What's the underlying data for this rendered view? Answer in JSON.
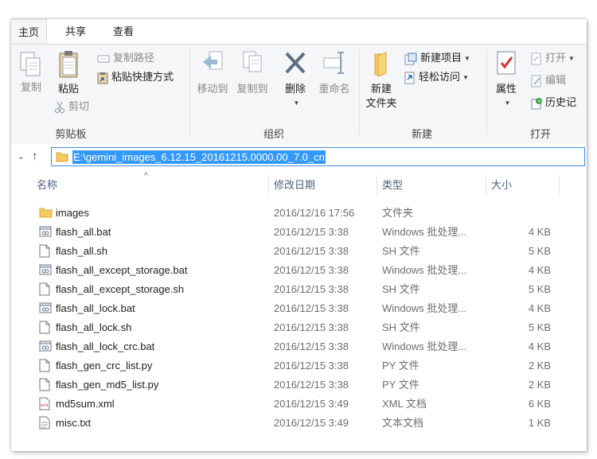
{
  "tabs": [
    "主页",
    "共享",
    "查看"
  ],
  "clipboard": {
    "copy": "复制",
    "paste": "粘贴",
    "copy_path": "复制路径",
    "paste_shortcut": "粘贴快捷方式",
    "cut": "剪切",
    "group": "剪贴板"
  },
  "organize": {
    "move_to": "移动到",
    "copy_to": "复制到",
    "delete": "删除",
    "rename": "重命名",
    "group": "组织"
  },
  "new": {
    "new_folder_line1": "新建",
    "new_folder_line2": "文件夹",
    "new_item": "新建项目",
    "easy_access": "轻松访问",
    "group": "新建"
  },
  "open": {
    "properties": "属性",
    "open": "打开",
    "edit": "编辑",
    "history": "历史记",
    "group": "打开"
  },
  "address": {
    "path": "E:\\gemini_images_6.12.15_20161215.0000.00_7.0_cn"
  },
  "columns": {
    "name": "名称",
    "date": "修改日期",
    "type": "类型",
    "size": "大小"
  },
  "files": [
    {
      "name": "images",
      "date": "2016/12/16 17:56",
      "type": "文件夹",
      "size": "",
      "icon": "folder"
    },
    {
      "name": "flash_all.bat",
      "date": "2016/12/15 3:38",
      "type": "Windows 批处理...",
      "size": "4 KB",
      "icon": "bat"
    },
    {
      "name": "flash_all.sh",
      "date": "2016/12/15 3:38",
      "type": "SH 文件",
      "size": "5 KB",
      "icon": "doc"
    },
    {
      "name": "flash_all_except_storage.bat",
      "date": "2016/12/15 3:38",
      "type": "Windows 批处理...",
      "size": "4 KB",
      "icon": "bat"
    },
    {
      "name": "flash_all_except_storage.sh",
      "date": "2016/12/15 3:38",
      "type": "SH 文件",
      "size": "5 KB",
      "icon": "doc"
    },
    {
      "name": "flash_all_lock.bat",
      "date": "2016/12/15 3:38",
      "type": "Windows 批处理...",
      "size": "4 KB",
      "icon": "bat"
    },
    {
      "name": "flash_all_lock.sh",
      "date": "2016/12/15 3:38",
      "type": "SH 文件",
      "size": "5 KB",
      "icon": "doc"
    },
    {
      "name": "flash_all_lock_crc.bat",
      "date": "2016/12/15 3:38",
      "type": "Windows 批处理...",
      "size": "4 KB",
      "icon": "bat"
    },
    {
      "name": "flash_gen_crc_list.py",
      "date": "2016/12/15 3:38",
      "type": "PY 文件",
      "size": "2 KB",
      "icon": "doc"
    },
    {
      "name": "flash_gen_md5_list.py",
      "date": "2016/12/15 3:38",
      "type": "PY 文件",
      "size": "2 KB",
      "icon": "doc"
    },
    {
      "name": "md5sum.xml",
      "date": "2016/12/15 3:49",
      "type": "XML 文档",
      "size": "6 KB",
      "icon": "xml"
    },
    {
      "name": "misc.txt",
      "date": "2016/12/15 3:49",
      "type": "文本文档",
      "size": "1 KB",
      "icon": "txt"
    }
  ],
  "colors": {
    "accent": "#3399ff",
    "folder": "#f4c95d",
    "ribbon_bg": "#f5f6f7"
  }
}
